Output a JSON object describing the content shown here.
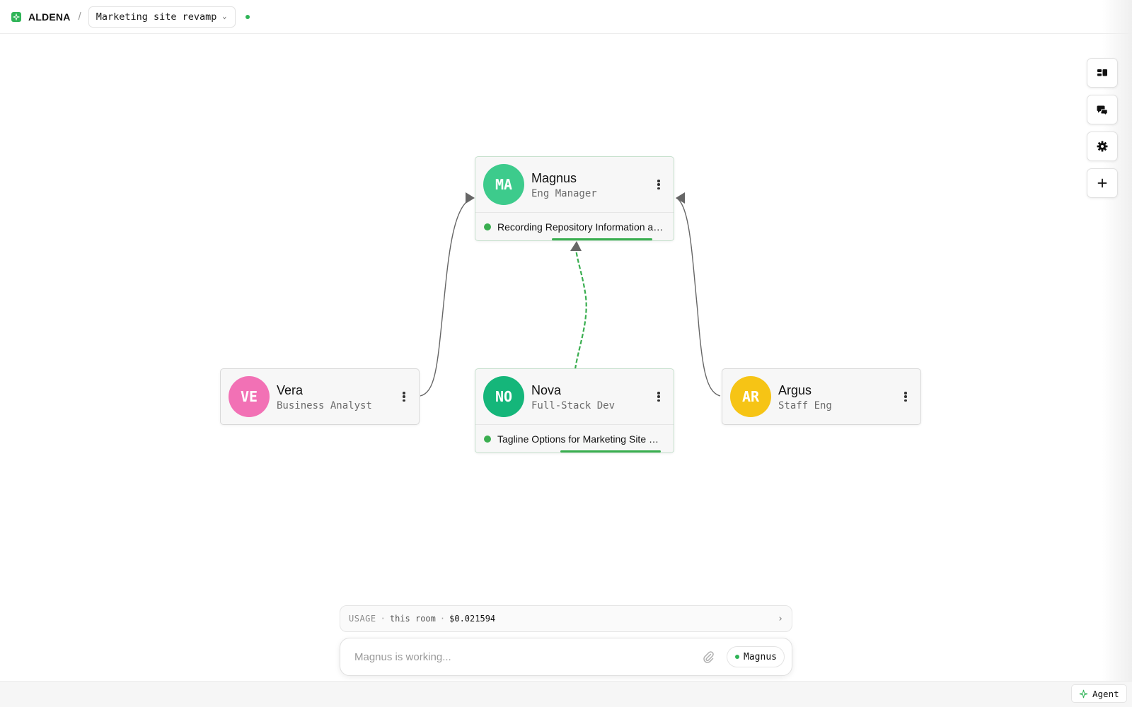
{
  "header": {
    "brand": "ALDENA",
    "separator": "/",
    "project": "Marketing site revamp"
  },
  "rail": [
    {
      "name": "layout-icon"
    },
    {
      "name": "chat-icon"
    },
    {
      "name": "settings-icon"
    },
    {
      "name": "plus-icon"
    }
  ],
  "agents": {
    "magnus": {
      "initials": "MA",
      "name": "Magnus",
      "role": "Eng Manager",
      "color": "#3dcb8c",
      "task": "Recording Repository Information and Design Context"
    },
    "vera": {
      "initials": "VE",
      "name": "Vera",
      "role": "Business Analyst",
      "color": "#f271b5"
    },
    "nova": {
      "initials": "NO",
      "name": "Nova",
      "role": "Full-Stack Dev",
      "color": "#15b67a",
      "task": "Tagline Options for Marketing Site Hero"
    },
    "argus": {
      "initials": "AR",
      "name": "Argus",
      "role": "Staff Eng",
      "color": "#f6c415"
    }
  },
  "usage": {
    "label": "USAGE",
    "sep": "·",
    "scope": "this room",
    "cost": "$0.021594"
  },
  "composer": {
    "placeholder": "Magnus is working...",
    "target": "Magnus"
  },
  "statusbar": {
    "agent_label": "Agent"
  }
}
